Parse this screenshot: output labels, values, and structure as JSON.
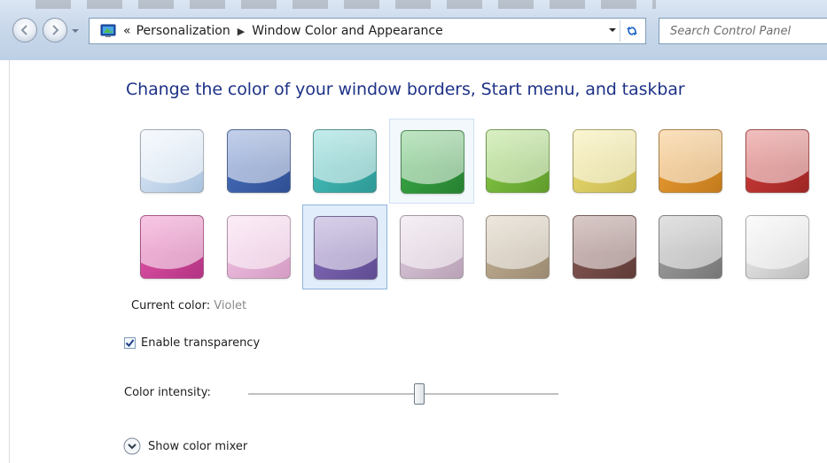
{
  "address_bar": {
    "overflow": "«",
    "breadcrumb": [
      "Personalization",
      "Window Color and Appearance"
    ],
    "search_placeholder": "Search Control Panel"
  },
  "heading": "Change the color of your window borders, Start menu, and taskbar",
  "swatches": [
    {
      "color": "#e6f0fb",
      "edge": "#a9c2dd"
    },
    {
      "color": "#4d74c4",
      "edge": "#2f4f93"
    },
    {
      "color": "#4ec8c4",
      "edge": "#2d9895"
    },
    {
      "color": "#3eb34a",
      "edge": "#278031"
    },
    {
      "color": "#8ed24c",
      "edge": "#5f9b2b"
    },
    {
      "color": "#f1e27a",
      "edge": "#c7b74e"
    },
    {
      "color": "#f4a53a",
      "edge": "#c27a1c"
    },
    {
      "color": "#d8403e",
      "edge": "#9d2624"
    },
    {
      "color": "#ea5ab0",
      "edge": "#b33382"
    },
    {
      "color": "#f6c8e8",
      "edge": "#d49cc4"
    },
    {
      "color": "#8c72c0",
      "edge": "#5e4b92"
    },
    {
      "color": "#e2cde0",
      "edge": "#b9a2b7"
    },
    {
      "color": "#c8b79c",
      "edge": "#9b8a71"
    },
    {
      "color": "#8e5f5a",
      "edge": "#5f3b37"
    },
    {
      "color": "#a9a9a9",
      "edge": "#767676"
    },
    {
      "color": "#f2f2f2",
      "edge": "#bdbdbd"
    }
  ],
  "current_color": {
    "label": "Current color:",
    "value": "Violet"
  },
  "transparency": {
    "label": "Enable transparency",
    "checked": true
  },
  "intensity": {
    "label": "Color intensity:",
    "level": 0.55
  },
  "mixer": {
    "label": "Show color mixer"
  }
}
